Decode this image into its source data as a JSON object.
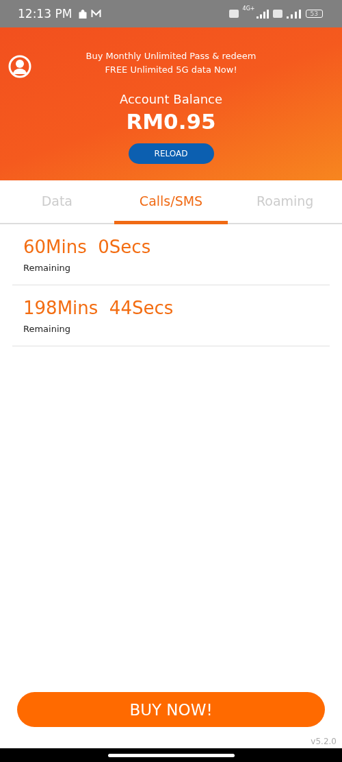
{
  "status_bar": {
    "time": "12:13 PM",
    "network": "4G+",
    "battery": "53"
  },
  "header": {
    "promo": "Buy Monthly Unlimited Pass & redeem\nFREE Unlimited 5G data Now!",
    "balance_label": "Account Balance",
    "balance": "RM0.95",
    "reload_button": "RELOAD"
  },
  "tabs": [
    {
      "label": "Data",
      "selected": false
    },
    {
      "label": "Calls/SMS",
      "selected": true
    },
    {
      "label": "Roaming",
      "selected": false
    }
  ],
  "items": [
    {
      "amount": "60Mins  0Secs",
      "caption": "Remaining"
    },
    {
      "amount": "198Mins  44Secs",
      "caption": "Remaining"
    }
  ],
  "buy_button": "BUY NOW!",
  "version": "v5.2.0"
}
